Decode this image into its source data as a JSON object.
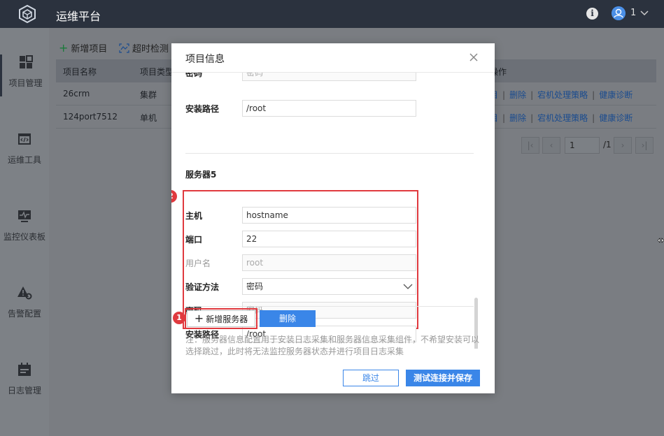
{
  "app": {
    "title": "运维平台",
    "user_name": "1"
  },
  "sidebar": {
    "items": [
      {
        "label": "项目管理",
        "icon": "grid-icon",
        "active": true
      },
      {
        "label": "运维工具",
        "icon": "code-window-icon",
        "active": false
      },
      {
        "label": "监控仪表板",
        "icon": "monitor-pulse-icon",
        "active": false
      },
      {
        "label": "告警配置",
        "icon": "alert-gear-icon",
        "active": false
      },
      {
        "label": "日志管理",
        "icon": "calendar-log-icon",
        "active": false
      }
    ]
  },
  "toolbar": {
    "add_project": "新增项目",
    "timeout_check": "超时检测"
  },
  "table": {
    "columns": [
      "项目名称",
      "项目类型",
      "操作"
    ],
    "rows": [
      {
        "name": "26crm",
        "type": "集群"
      },
      {
        "name": "124port7512",
        "type": "单机"
      }
    ],
    "ops": [
      "目",
      "删除",
      "宕机处理策略",
      "健康诊断"
    ]
  },
  "pager": {
    "current": "1",
    "total": "/1"
  },
  "modal": {
    "title": "项目信息",
    "prev_server": {
      "password_label": "密码",
      "password_placeholder": "密码",
      "path_label": "安装路径",
      "path_value": "/root"
    },
    "section_title": "服务器5",
    "server": {
      "host_label": "主机",
      "host_value": "hostname",
      "port_label": "端口",
      "port_value": "22",
      "user_label": "用户名",
      "user_placeholder": "root",
      "auth_label": "验证方法",
      "auth_value": "密码",
      "password_label": "密码",
      "password_placeholder": "密码",
      "path_label": "安装路径",
      "path_value": "/root"
    },
    "add_server": "新增服务器",
    "delete": "删除",
    "note": "注：服务器信息配置用于安装日志采集和服务器信息采集组件，不希望安装可以选择跳过，此时将无法监控服务器状态并进行项目日志采集",
    "skip": "跳过",
    "test_save": "测试连接并保存",
    "badges": [
      "1",
      "2"
    ]
  },
  "colors": {
    "accent": "#3a86e8",
    "highlight": "#e0393e",
    "topbar": "#2b323e"
  }
}
